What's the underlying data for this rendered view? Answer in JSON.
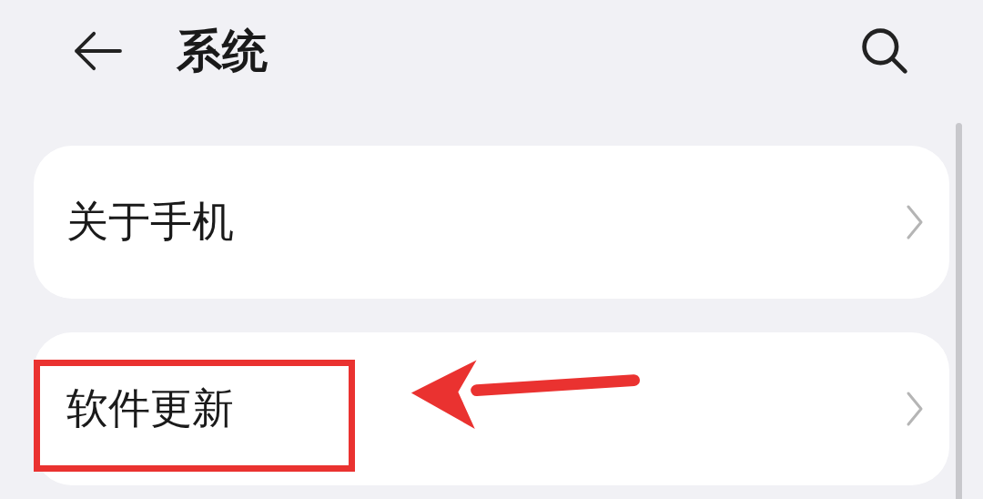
{
  "header": {
    "title": "系统"
  },
  "items": [
    {
      "label": "关于手机",
      "highlighted": false
    },
    {
      "label": "软件更新",
      "highlighted": true
    }
  ]
}
